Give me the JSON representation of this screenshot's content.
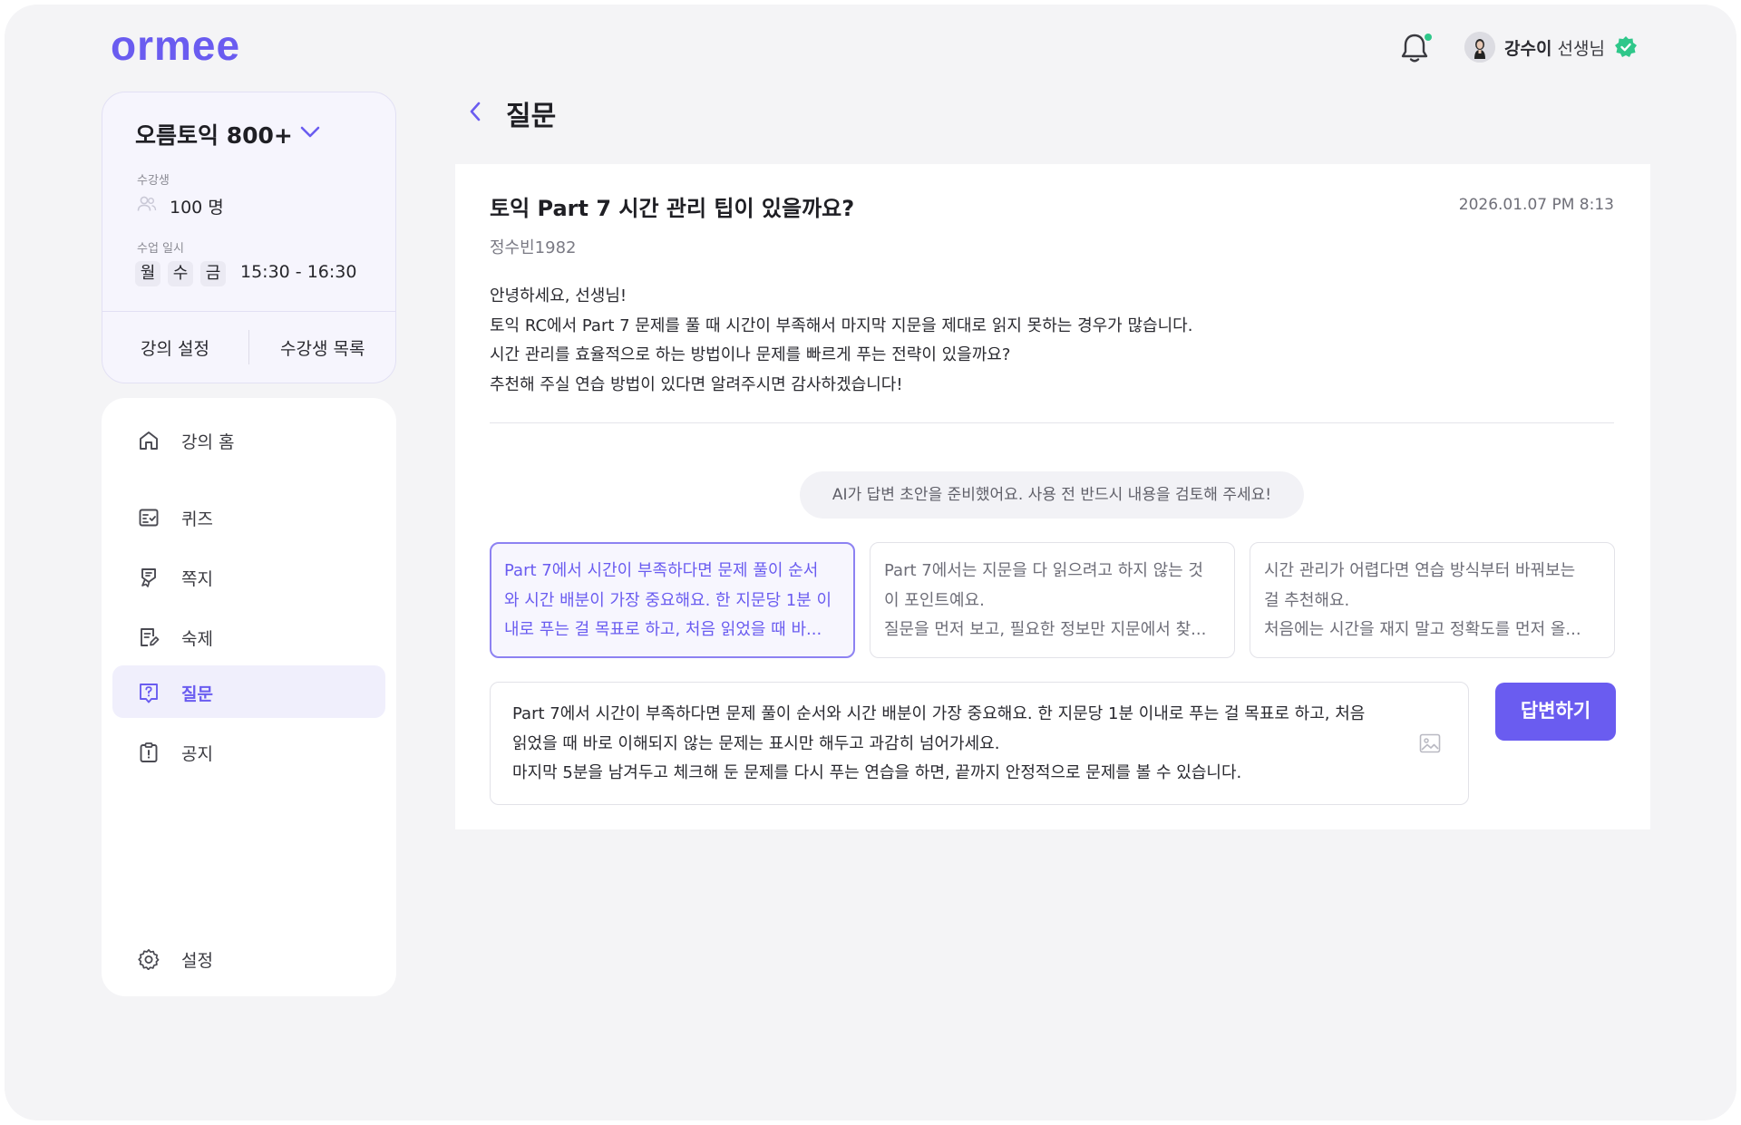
{
  "brand": {
    "logo": "ormee",
    "accent": "#6a5cf0"
  },
  "header": {
    "user_name": "강수이",
    "user_suffix": "선생님",
    "icons": [
      "bell-icon",
      "avatar",
      "verified-badge-icon"
    ]
  },
  "course": {
    "title": "오름토익 800+",
    "students_label": "수강생",
    "students_value": "100 명",
    "schedule_label": "수업 일시",
    "days": [
      "월",
      "수",
      "금"
    ],
    "time": "15:30 - 16:30",
    "settings_link": "강의 설정",
    "students_link": "수강생 목록"
  },
  "nav": {
    "items": [
      {
        "label": "강의 홈",
        "icon": "home-icon"
      },
      {
        "label": "퀴즈",
        "icon": "quiz-icon"
      },
      {
        "label": "쪽지",
        "icon": "memo-icon"
      },
      {
        "label": "숙제",
        "icon": "homework-icon"
      },
      {
        "label": "질문",
        "icon": "question-icon",
        "active": true
      },
      {
        "label": "공지",
        "icon": "notice-icon"
      }
    ],
    "settings": {
      "label": "설정",
      "icon": "gear-icon"
    }
  },
  "page": {
    "title": "질문"
  },
  "question": {
    "title": "토익 Part 7 시간 관리 팁이 있을까요?",
    "datetime": "2026.01.07  PM 8:13",
    "author": "정수빈1982",
    "body": [
      "안녕하세요, 선생님!",
      "토익 RC에서 Part 7 문제를 풀 때 시간이 부족해서 마지막 지문을 제대로 읽지 못하는 경우가 많습니다.",
      "시간 관리를 효율적으로 하는 방법이나 문제를 빠르게 푸는 전략이 있을까요?",
      "추천해 주실 연습 방법이 있다면 알려주시면 감사하겠습니다!"
    ]
  },
  "ai": {
    "notice": "AI가 답변 초안을 준비했어요. 사용 전 반드시 내용을 검토해 주세요!",
    "drafts": [
      {
        "lines": [
          "Part 7에서 시간이 부족하다면 문제 풀이 순서",
          "와 시간 배분이 가장 중요해요. 한 지문당 1분 이",
          "내로 푸는 걸 목표로 하고, 처음 읽었을 때 바..."
        ]
      },
      {
        "lines": [
          "Part 7에서는 지문을 다 읽으려고 하지 않는 것",
          "이 포인트예요.",
          "질문을 먼저 보고, 필요한 정보만 지문에서 찾..."
        ]
      },
      {
        "lines": [
          "시간 관리가 어렵다면 연습 방식부터 바꿔보는",
          "걸 추천해요.",
          "처음에는 시간을 재지 말고 정확도를 먼저 올..."
        ]
      }
    ]
  },
  "answer": {
    "lines": [
      "Part 7에서 시간이 부족하다면 문제 풀이 순서와 시간 배분이 가장 중요해요. 한 지문당 1분 이내로 푸는 걸 목표로 하고, 처음",
      "읽었을 때 바로 이해되지 않는 문제는 표시만 해두고 과감히 넘어가세요.",
      "마지막 5분을 남겨두고 체크해 둔 문제를 다시 푸는 연습을 하면, 끝까지 안정적으로 문제를 볼 수 있습니다."
    ],
    "submit_label": "답변하기"
  }
}
